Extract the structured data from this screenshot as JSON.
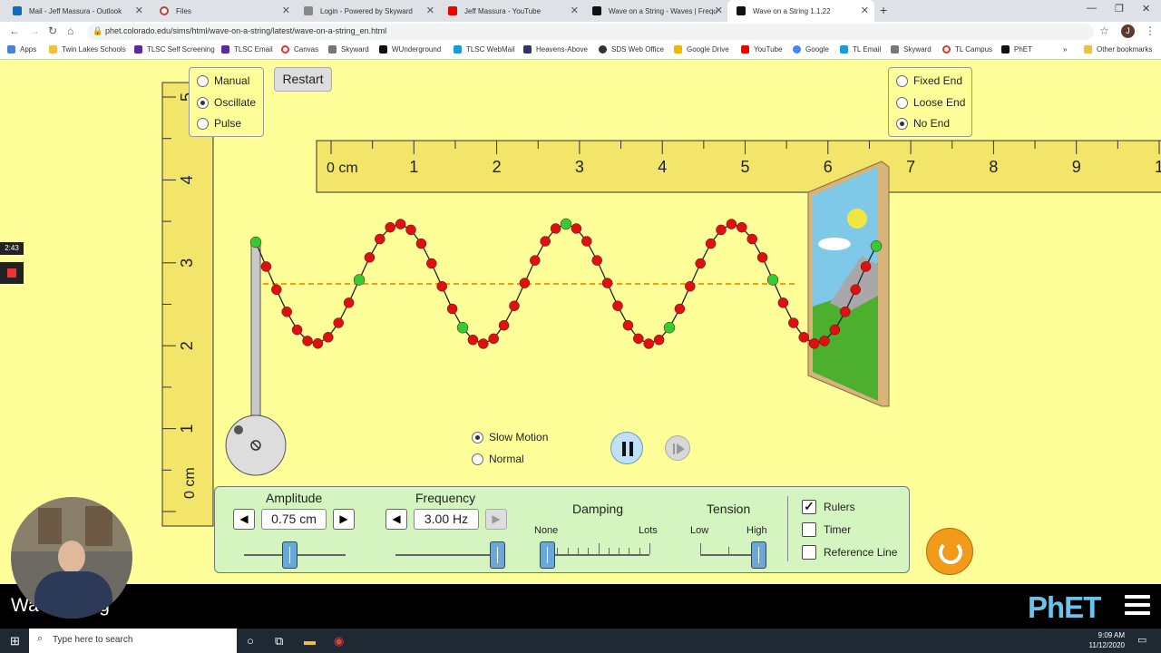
{
  "browser": {
    "tabs": [
      {
        "title": "Mail - Jeff Massura - Outlook",
        "color": "#0f6cbd"
      },
      {
        "title": "Files",
        "color": "#c83a3a"
      },
      {
        "title": "Login - Powered by Skyward",
        "color": "#666"
      },
      {
        "title": "Jeff Massura - YouTube",
        "color": "#e00"
      },
      {
        "title": "Wave on a String - Waves | Frequ",
        "color": "#111"
      },
      {
        "title": "Wave on a String 1.1.22",
        "color": "#111"
      }
    ],
    "url": "phet.colorado.edu/sims/html/wave-on-a-string/latest/wave-on-a-string_en.html",
    "bookmarks": [
      "Apps",
      "Twin Lakes Schools",
      "TLSC Self Screening",
      "TLSC Email",
      "Canvas",
      "Skyward",
      "WUnderground",
      "TLSC WebMail",
      "Heavens-Above",
      "SDS Web Office",
      "Google Drive",
      "YouTube",
      "Google",
      "TL Email",
      "Skyward",
      "TL Campus",
      "PhET"
    ],
    "other_bookmarks": "Other bookmarks",
    "profile_initial": "J"
  },
  "sim": {
    "mode_options": [
      "Manual",
      "Oscillate",
      "Pulse"
    ],
    "mode_selected": "Oscillate",
    "restart_label": "Restart",
    "end_options": [
      "Fixed End",
      "Loose End",
      "No End"
    ],
    "end_selected": "No End",
    "h_ruler": {
      "unit_label": "0 cm",
      "ticks": [
        "1",
        "2",
        "3",
        "4",
        "5",
        "6",
        "7",
        "8",
        "9",
        "1"
      ]
    },
    "v_ruler": {
      "unit_label": "0 cm",
      "ticks": [
        "1",
        "2",
        "3",
        "4",
        "5"
      ]
    },
    "speed_options": [
      "Slow Motion",
      "Normal"
    ],
    "speed_selected": "Slow Motion",
    "amplitude": {
      "label": "Amplitude",
      "value": "0.75 cm",
      "level": 0.45
    },
    "frequency": {
      "label": "Frequency",
      "value": "3.00 Hz",
      "level": 1.0
    },
    "damping": {
      "label": "Damping",
      "min": "None",
      "max": "Lots",
      "level": 0.0
    },
    "tension": {
      "label": "Tension",
      "min": "Low",
      "max": "High",
      "level": 1.0
    },
    "checkboxes": [
      {
        "label": "Rulers",
        "checked": true
      },
      {
        "label": "Timer",
        "checked": false
      },
      {
        "label": "Reference Line",
        "checked": false
      }
    ]
  },
  "overlay": {
    "timer": "2:43",
    "caption": "Wave on a String",
    "caption_visible": "Wa        a String",
    "logo": "PhET"
  },
  "taskbar": {
    "search_placeholder": "Type here to search",
    "time": "9:09 AM",
    "date": "11/12/2020"
  },
  "colors": {
    "sim_bg": "#ffff99",
    "panel": "#d4f5c0",
    "bead": "#dd1111",
    "bead_marker": "#33cc33",
    "ref_line": "#ff9900"
  }
}
